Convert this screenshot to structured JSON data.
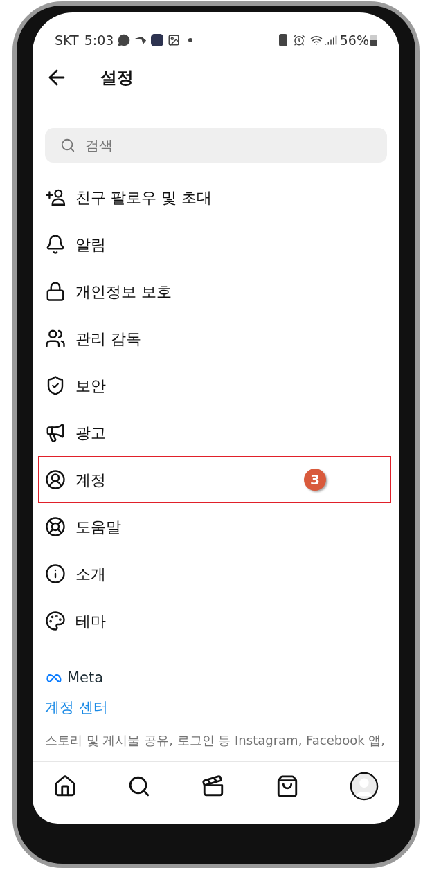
{
  "status_bar": {
    "carrier": "SKT",
    "time": "5:03",
    "battery": "56%"
  },
  "header": {
    "title": "설정"
  },
  "search": {
    "placeholder": "검색"
  },
  "menu": [
    {
      "label": "친구 팔로우 및 초대",
      "highlighted": false
    },
    {
      "label": "알림",
      "highlighted": false
    },
    {
      "label": "개인정보 보호",
      "highlighted": false
    },
    {
      "label": "관리 감독",
      "highlighted": false
    },
    {
      "label": "보안",
      "highlighted": false
    },
    {
      "label": "광고",
      "highlighted": false
    },
    {
      "label": "계정",
      "highlighted": true,
      "step": "3"
    },
    {
      "label": "도움말",
      "highlighted": false
    },
    {
      "label": "소개",
      "highlighted": false
    },
    {
      "label": "테마",
      "highlighted": false
    }
  ],
  "meta_section": {
    "brand": "Meta",
    "link": "계정 센터",
    "description": "스토리 및 게시물 공유, 로그인 등 Instagram, Facebook 앱,"
  }
}
